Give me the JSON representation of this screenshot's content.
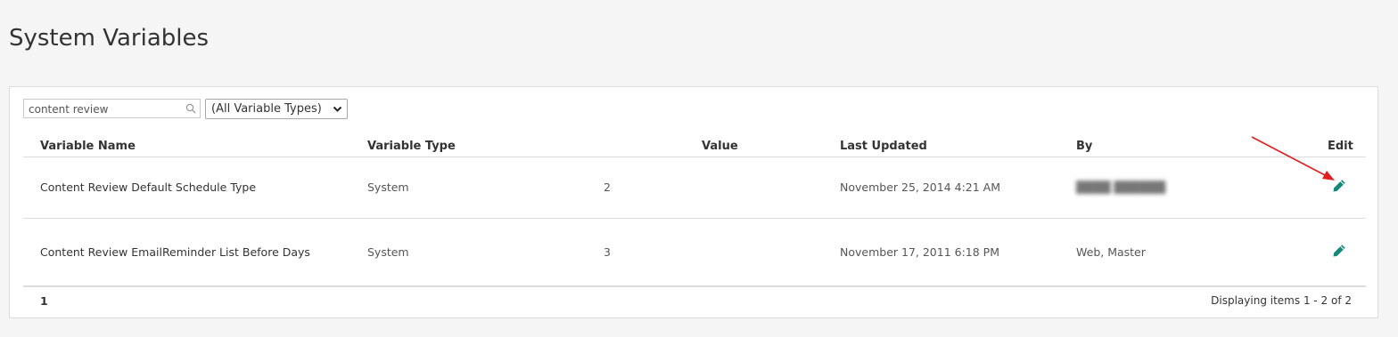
{
  "page": {
    "title": "System Variables"
  },
  "toolbar": {
    "search_value": "content review",
    "search_icon": "search-icon",
    "type_filter_selected": "(All Variable Types)"
  },
  "table": {
    "columns": {
      "name": "Variable Name",
      "type": "Variable Type",
      "value": "Value",
      "updated": "Last Updated",
      "by": "By",
      "edit": "Edit"
    },
    "rows": [
      {
        "name": "Content Review Default Schedule Type",
        "type": "System",
        "value": "2",
        "updated": "November 25, 2014 4:21 AM",
        "by": "████ ██████",
        "edit_icon": "pencil-icon"
      },
      {
        "name": "Content Review EmailReminder List Before Days",
        "type": "System",
        "value": "3",
        "updated": "November 17, 2011 6:18 PM",
        "by": "Web, Master",
        "edit_icon": "pencil-icon"
      }
    ]
  },
  "pager": {
    "current_page": "1",
    "info": "Displaying items 1 - 2 of 2"
  },
  "colors": {
    "edit_icon": "#168a7a",
    "annotation_arrow": "#e02020",
    "border": "#dcdcdc"
  }
}
